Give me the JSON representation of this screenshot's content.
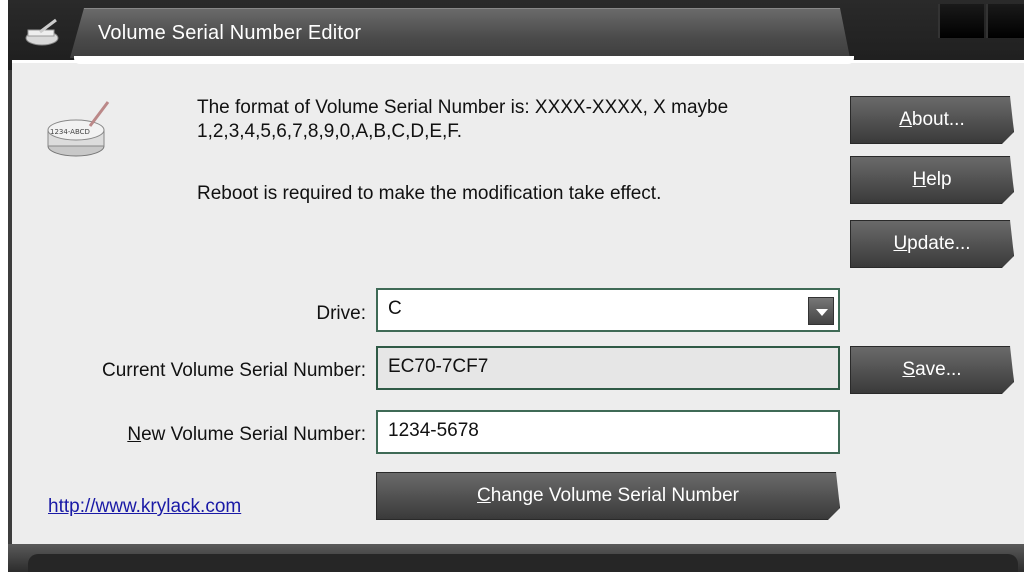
{
  "window": {
    "title": "Volume Serial Number Editor"
  },
  "info": {
    "format_line": "The format of Volume Serial Number is: XXXX-XXXX, X maybe 1,2,3,4,5,6,7,8,9,0,A,B,C,D,E,F.",
    "reboot_line": "Reboot is required to make the modification take effect."
  },
  "side_buttons": {
    "about": {
      "mnemonic": "A",
      "rest": "bout..."
    },
    "help": {
      "mnemonic": "H",
      "rest": "elp"
    },
    "update": {
      "mnemonic": "U",
      "rest": "pdate..."
    },
    "save": {
      "mnemonic": "S",
      "rest": "ave..."
    }
  },
  "form": {
    "drive_label": "Drive:",
    "drive_value": "C",
    "current_label": "Current Volume Serial Number:",
    "current_value": "EC70-7CF7",
    "new_label_mnemonic": "N",
    "new_label_rest": "ew Volume Serial Number:",
    "new_value": "1234-5678"
  },
  "change_button": {
    "mnemonic": "C",
    "rest": "hange Volume Serial Number"
  },
  "link": {
    "text": "http://www.krylack.com"
  },
  "icon_badge_text": "1234-ABCD",
  "colors": {
    "accent": "#3f6a56",
    "chrome": "#3c3c3c",
    "link": "#1a1aa6"
  }
}
